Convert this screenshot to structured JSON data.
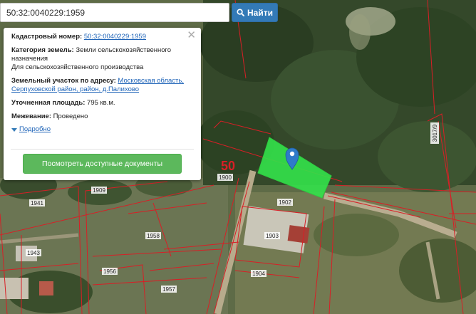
{
  "search": {
    "value": "50:32:0040229:1959",
    "button_label": "Найти"
  },
  "popup": {
    "cadastral_label": "Кадастровый номер:",
    "cadastral_value": "50:32:0040229:1959",
    "category_label": "Категория земель:",
    "category_value_1": "Земли сельскохозяйственного",
    "category_value_2": "назначения",
    "category_value_3": "Для сельскохозяйственного производства",
    "address_label": "Земельный участок по адресу:",
    "address_value_1": "Московская область,",
    "address_value_2": "Серпуховской район, район, д.Палихово",
    "area_label": "Уточненная площадь:",
    "area_value": "795 кв.м.",
    "survey_label": "Межевание:",
    "survey_value": "Проведено",
    "more_label": "Подробно",
    "docs_button": "Посмотреть доступные документы"
  },
  "map": {
    "block_number": "50",
    "parcel_labels": [
      "1900",
      "1909",
      "1941",
      "1902",
      "1903",
      "1958",
      "1943",
      "1956",
      "1904",
      "1957",
      "3017/9"
    ],
    "colors": {
      "highlight": "#33e24a",
      "boundary": "#d81f26",
      "marker": "#2f7ac9"
    }
  }
}
